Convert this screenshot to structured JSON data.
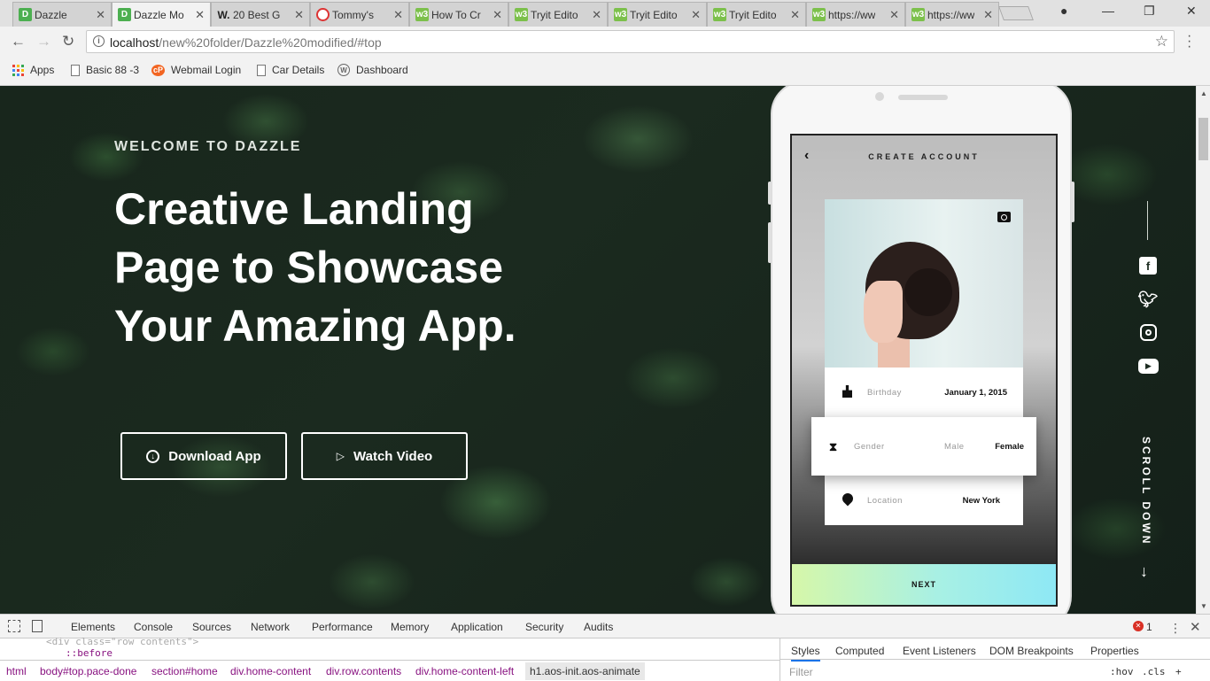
{
  "browser": {
    "tabs": [
      {
        "favicon": "D",
        "title": "Dazzle",
        "active": false
      },
      {
        "favicon": "D",
        "title": "Dazzle Mo",
        "active": true
      },
      {
        "favicon": "W.",
        "title": "20 Best G",
        "active": false
      },
      {
        "favicon": "T",
        "title": "Tommy's",
        "active": false
      },
      {
        "favicon": "w3",
        "title": "How To Cr",
        "active": false
      },
      {
        "favicon": "w3",
        "title": "Tryit Edito",
        "active": false
      },
      {
        "favicon": "w3",
        "title": "Tryit Edito",
        "active": false
      },
      {
        "favicon": "w3",
        "title": "Tryit Edito",
        "active": false
      },
      {
        "favicon": "w3",
        "title": "https://ww",
        "active": false
      },
      {
        "favicon": "w3",
        "title": "https://ww",
        "active": false
      }
    ],
    "url_host": "localhost",
    "url_path": "/new%20folder/Dazzle%20modified/#top",
    "bookmarks": [
      "Apps",
      "Basic 88 -3",
      "Webmail Login",
      "Car Details",
      "Dashboard"
    ]
  },
  "hero": {
    "welcome": "WELCOME TO DAZZLE",
    "headline_1": "Creative Landing",
    "headline_2": "Page to Showcase",
    "headline_3": "Your Amazing App.",
    "download_label": "Download App",
    "video_label": "Watch Video"
  },
  "phone": {
    "title": "CREATE ACCOUNT",
    "birthday_label": "Birthday",
    "birthday_value": "January 1, 2015",
    "gender_label": "Gender",
    "gender_male": "Male",
    "gender_female": "Female",
    "location_label": "Location",
    "location_value": "New York",
    "next_label": "NEXT"
  },
  "side": {
    "scroll_label": "SCROLL DOWN"
  },
  "devtools": {
    "tabs": [
      "Elements",
      "Console",
      "Sources",
      "Network",
      "Performance",
      "Memory",
      "Application",
      "Security",
      "Audits"
    ],
    "error_count": "1",
    "code_line_1": "<div class=\"row contents\">",
    "code_line_2": "::before",
    "crumbs": [
      "html",
      "body#top.pace-done",
      "section#home",
      "div.home-content",
      "div.row.contents",
      "div.home-content-left",
      "h1.aos-init.aos-animate"
    ],
    "side_tabs": [
      "Styles",
      "Computed",
      "Event Listeners",
      "DOM Breakpoints",
      "Properties"
    ],
    "filter_placeholder": "Filter",
    "hov": ":hov",
    "cls": ".cls",
    "plus": "+"
  },
  "colors": {
    "accent": "#1a73e8",
    "hero_bg": "#1b2a1f",
    "next_gradient_start": "#d6f7a9",
    "next_gradient_end": "#8ee8f5"
  }
}
